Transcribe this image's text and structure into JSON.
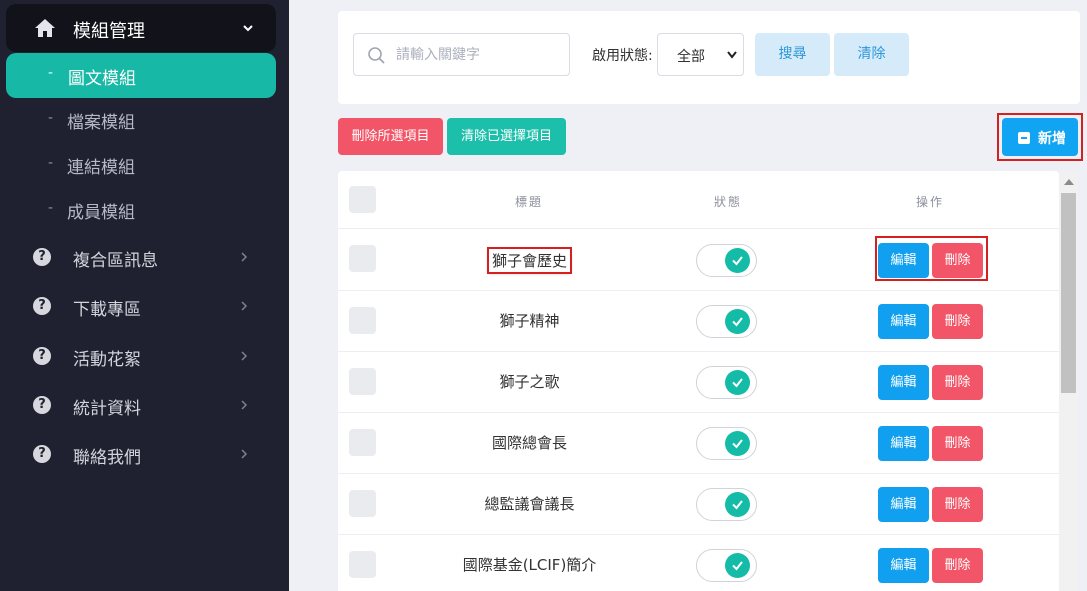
{
  "sidebar": {
    "header": {
      "label": "模組管理",
      "icon": "home-icon"
    },
    "sub_items": [
      {
        "label": "圖文模組",
        "active": true
      },
      {
        "label": "檔案模組",
        "active": false
      },
      {
        "label": "連結模組",
        "active": false
      },
      {
        "label": "成員模組",
        "active": false
      }
    ],
    "sub_dash": "-",
    "menu_items": [
      {
        "label": "複合區訊息",
        "icon": "question-circle-icon"
      },
      {
        "label": "下載專區",
        "icon": "question-circle-icon"
      },
      {
        "label": "活動花絮",
        "icon": "question-circle-icon"
      },
      {
        "label": "統計資料",
        "icon": "question-circle-icon"
      },
      {
        "label": "聯絡我們",
        "icon": "question-circle-icon"
      }
    ],
    "question_glyph": "?"
  },
  "search": {
    "placeholder": "請輸入關鍵字",
    "status_label": "啟用狀態:",
    "status_selected": "全部",
    "search_button": "搜尋",
    "clear_button": "清除"
  },
  "actions": {
    "delete_selected": "刪除所選項目",
    "clear_selected": "清除已選擇項目",
    "add": "新增"
  },
  "table": {
    "headers": {
      "title": "標題",
      "status": "狀態",
      "actions": "操作"
    },
    "rows": [
      {
        "title": "獅子會歷史",
        "enabled": true
      },
      {
        "title": "獅子精神",
        "enabled": true
      },
      {
        "title": "獅子之歌",
        "enabled": true
      },
      {
        "title": "國際總會長",
        "enabled": true
      },
      {
        "title": "總監議會議長",
        "enabled": true
      },
      {
        "title": "國際基金(LCIF)簡介",
        "enabled": true
      }
    ],
    "edit_label": "編輯",
    "delete_label": "刪除"
  },
  "colors": {
    "sidebar_bg": "#1f2130",
    "active_item": "#17b8a6",
    "primary": "#10a4f2",
    "danger": "#f25567",
    "teal": "#1cc0aa",
    "highlight": "#d4211f"
  }
}
